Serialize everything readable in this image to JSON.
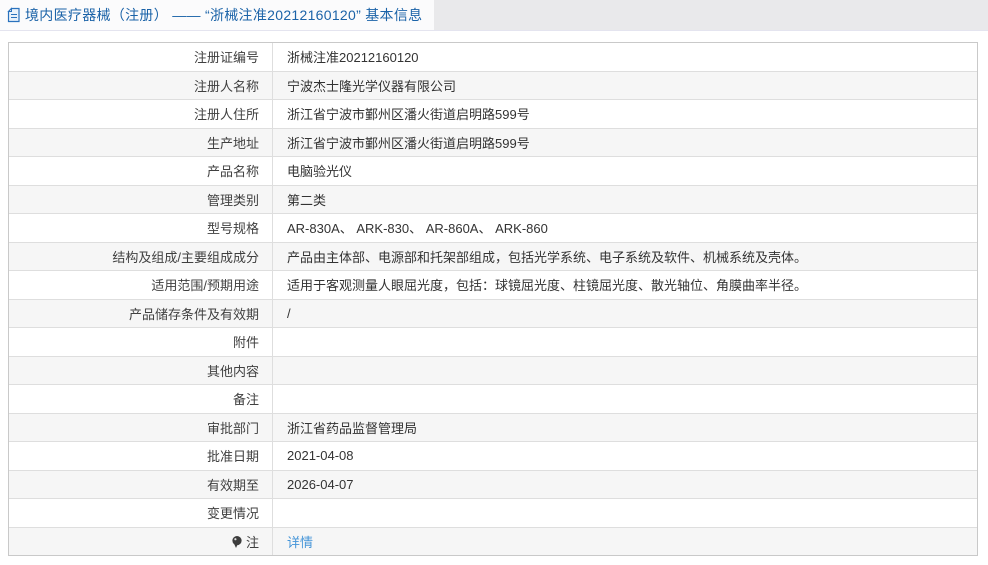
{
  "header": {
    "icon": "document-icon",
    "title": "境内医疗器械（注册） —— “浙械注准20212160120” 基本信息"
  },
  "table": {
    "rows": [
      {
        "label": "注册证编号",
        "value": "浙械注准20212160120"
      },
      {
        "label": "注册人名称",
        "value": "宁波杰士隆光学仪器有限公司"
      },
      {
        "label": "注册人住所",
        "value": "浙江省宁波市鄞州区潘火街道启明路599号"
      },
      {
        "label": "生产地址",
        "value": "浙江省宁波市鄞州区潘火街道启明路599号"
      },
      {
        "label": "产品名称",
        "value": "电脑验光仪"
      },
      {
        "label": "管理类别",
        "value": "第二类"
      },
      {
        "label": "型号规格",
        "value": "AR-830A、 ARK-830、 AR-860A、 ARK-860"
      },
      {
        "label": "结构及组成/主要组成成分",
        "value": "产品由主体部、电源部和托架部组成，包括光学系统、电子系统及软件、机械系统及壳体。"
      },
      {
        "label": "适用范围/预期用途",
        "value": "适用于客观测量人眼屈光度，包括：球镜屈光度、柱镜屈光度、散光轴位、角膜曲率半径。"
      },
      {
        "label": "产品储存条件及有效期",
        "value": "/"
      },
      {
        "label": "附件",
        "value": ""
      },
      {
        "label": "其他内容",
        "value": ""
      },
      {
        "label": "备注",
        "value": ""
      },
      {
        "label": "审批部门",
        "value": "浙江省药品监督管理局"
      },
      {
        "label": "批准日期",
        "value": "2021-04-08"
      },
      {
        "label": "有效期至",
        "value": "2026-04-07"
      },
      {
        "label": "变更情况",
        "value": ""
      },
      {
        "label": "注",
        "icon": "note-balloon-icon",
        "link": "详情"
      }
    ]
  },
  "colors": {
    "title_blue": "#1b63a8",
    "link_blue": "#4595d8",
    "bar_gray": "#e9e9eb",
    "stripe_gray": "#f6f6f6",
    "border_outer": "#c9c9c9",
    "border_inner": "#dedede",
    "text": "#333333"
  }
}
